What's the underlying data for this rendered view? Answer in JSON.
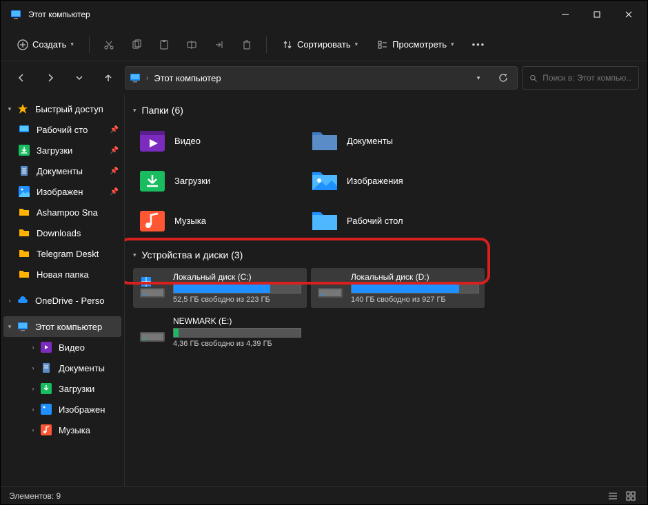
{
  "window": {
    "title": "Этот компьютер"
  },
  "toolbar": {
    "create": "Создать",
    "sort": "Сортировать",
    "view": "Просмотреть"
  },
  "breadcrumb": {
    "root": "Этот компьютер"
  },
  "search": {
    "placeholder": "Поиск в: Этот компью…"
  },
  "sidebar": {
    "quick": "Быстрый доступ",
    "desktop": "Рабочий сто",
    "downloads": "Загрузки",
    "documents": "Документы",
    "pictures": "Изображен",
    "ashampoo": "Ashampoo Sna",
    "downloads2": "Downloads",
    "telegram": "Telegram Deskt",
    "newfolder": "Новая папка",
    "onedrive": "OneDrive - Perso",
    "thispc": "Этот компьютер",
    "video": "Видео",
    "documents2": "Документы",
    "downloads3": "Загрузки",
    "pictures2": "Изображен",
    "music": "Музыка"
  },
  "groups": {
    "folders": "Папки (6)",
    "drives": "Устройства и диски (3)"
  },
  "folders": {
    "video": "Видео",
    "documents": "Документы",
    "downloads": "Загрузки",
    "pictures": "Изображения",
    "music": "Музыка",
    "desktop": "Рабочий стол"
  },
  "drivesData": [
    {
      "name": "Локальный диск (C:)",
      "free": "52,5 ГБ свободно из 223 ГБ",
      "fillPct": 76,
      "win": true,
      "sel": true
    },
    {
      "name": "Локальный диск (D:)",
      "free": "140 ГБ свободно из 927 ГБ",
      "fillPct": 85,
      "win": false,
      "sel": true
    },
    {
      "name": "NEWMARK (E:)",
      "free": "4,36 ГБ свободно из 4,39 ГБ",
      "fillPct": 4,
      "win": false,
      "ok": true
    }
  ],
  "status": {
    "count": "Элементов: 9"
  }
}
